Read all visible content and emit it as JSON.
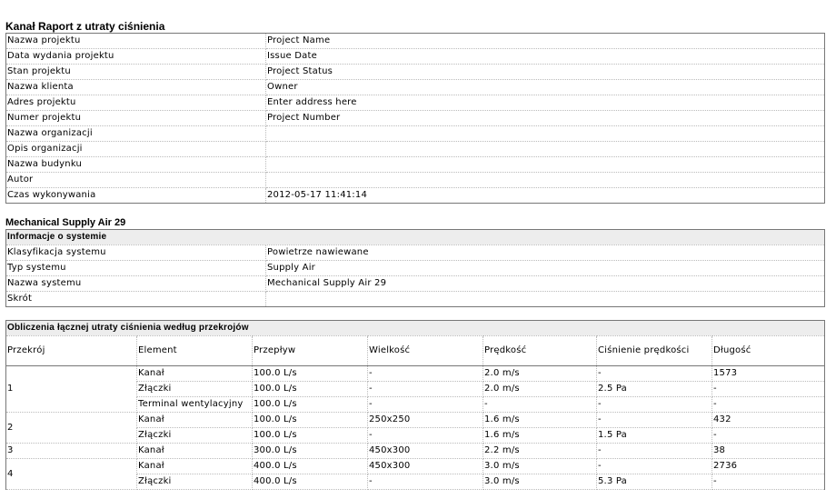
{
  "report": {
    "title": "Kanał Raport z utraty ciśnienia",
    "project_rows": [
      {
        "label": "Nazwa projektu",
        "value": "Project Name"
      },
      {
        "label": "Data wydania projektu",
        "value": "Issue Date"
      },
      {
        "label": "Stan projektu",
        "value": "Project Status"
      },
      {
        "label": "Nazwa klienta",
        "value": "Owner"
      },
      {
        "label": "Adres projektu",
        "value": "Enter address here"
      },
      {
        "label": "Numer projektu",
        "value": "Project Number"
      },
      {
        "label": "Nazwa organizacji",
        "value": ""
      },
      {
        "label": "Opis organizacji",
        "value": ""
      },
      {
        "label": "Nazwa budynku",
        "value": ""
      },
      {
        "label": "Autor",
        "value": ""
      },
      {
        "label": "Czas wykonywania",
        "value": "2012-05-17 11:41:14"
      }
    ]
  },
  "system": {
    "title": "Mechanical Supply Air 29",
    "info_header": "Informacje o systemie",
    "rows": [
      {
        "label": "Klasyfikacja systemu",
        "value": "Powietrze nawiewane"
      },
      {
        "label": "Typ systemu",
        "value": "Supply Air"
      },
      {
        "label": "Nazwa systemu",
        "value": "Mechanical Supply Air 29"
      },
      {
        "label": "Skrót",
        "value": ""
      }
    ]
  },
  "calc": {
    "title": "Obliczenia łącznej utraty ciśnienia według przekrojów",
    "columns": [
      "Przekrój",
      "Element",
      "Przepływ",
      "Wielkość",
      "Prędkość",
      "Ciśnienie prędkości",
      "Długość"
    ],
    "sections": [
      {
        "id": "1",
        "rows": [
          [
            "Kanał",
            "100.0 L/s",
            "-",
            "2.0 m/s",
            "-",
            "1573"
          ],
          [
            "Złączki",
            "100.0 L/s",
            "-",
            "2.0 m/s",
            "2.5 Pa",
            "-"
          ],
          [
            "Terminal wentylacyjny",
            "100.0 L/s",
            "-",
            "-",
            "-",
            "-"
          ]
        ]
      },
      {
        "id": "2",
        "rows": [
          [
            "Kanał",
            "100.0 L/s",
            "250x250",
            "1.6 m/s",
            "-",
            "432"
          ],
          [
            "Złączki",
            "100.0 L/s",
            "-",
            "1.6 m/s",
            "1.5 Pa",
            "-"
          ]
        ]
      },
      {
        "id": "3",
        "rows": [
          [
            "Kanał",
            "300.0 L/s",
            "450x300",
            "2.2 m/s",
            "-",
            "38"
          ]
        ]
      },
      {
        "id": "4",
        "rows": [
          [
            "Kanał",
            "400.0 L/s",
            "450x300",
            "3.0 m/s",
            "-",
            "2736"
          ],
          [
            "Złączki",
            "400.0 L/s",
            "-",
            "3.0 m/s",
            "5.3 Pa",
            "-"
          ]
        ]
      }
    ]
  }
}
